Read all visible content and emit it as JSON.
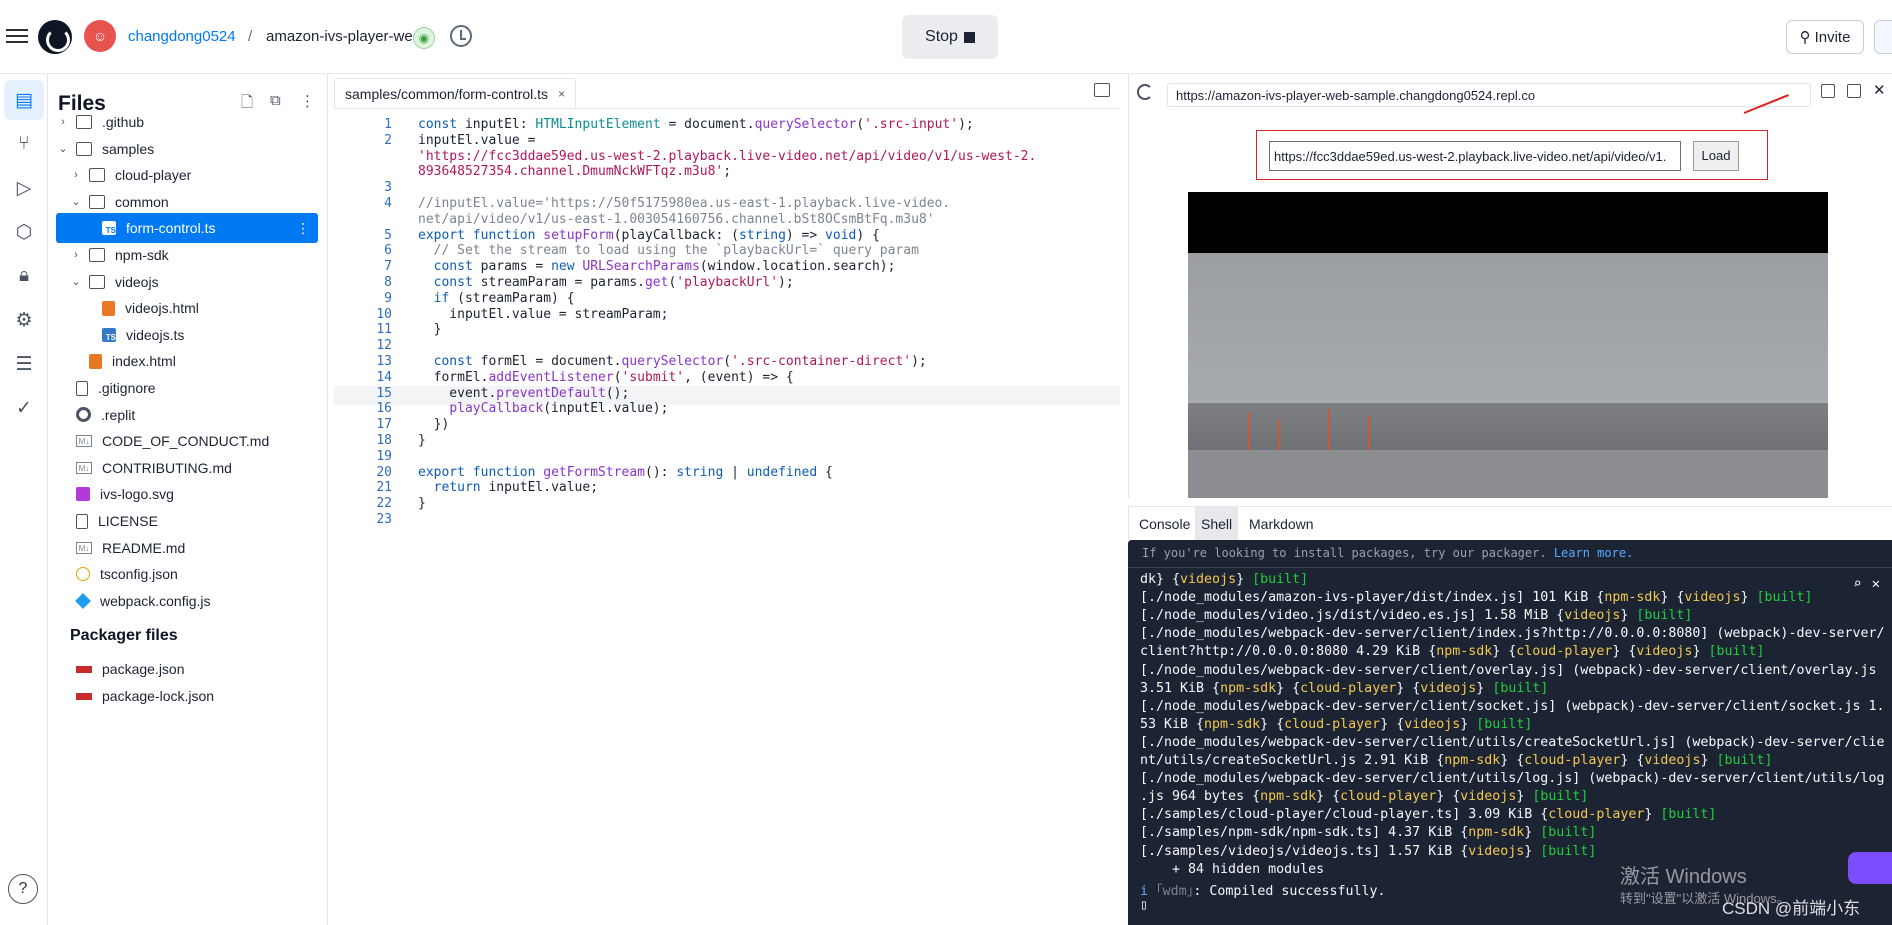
{
  "topbar": {
    "username": "changdong0524",
    "separator": "/",
    "repl_name": "amazon-ivs-player-we...",
    "stop_label": "Stop",
    "invite_label": "Invite",
    "avatar_glyph": "☺"
  },
  "files": {
    "title": "Files",
    "tree": [
      {
        "name": ".github",
        "kind": "folder",
        "chev": "›",
        "indent": 0
      },
      {
        "name": "samples",
        "kind": "folder",
        "chev": "⌄",
        "indent": 0
      },
      {
        "name": "cloud-player",
        "kind": "folder",
        "chev": "›",
        "indent": 1
      },
      {
        "name": "common",
        "kind": "folder",
        "chev": "⌄",
        "indent": 1
      },
      {
        "name": "form-control.ts",
        "kind": "ts",
        "chev": "",
        "indent": 2,
        "selected": true
      },
      {
        "name": "npm-sdk",
        "kind": "folder",
        "chev": "›",
        "indent": 1
      },
      {
        "name": "videojs",
        "kind": "folder",
        "chev": "⌄",
        "indent": 1
      },
      {
        "name": "videojs.html",
        "kind": "html",
        "chev": "",
        "indent": 2
      },
      {
        "name": "videojs.ts",
        "kind": "ts",
        "chev": "",
        "indent": 2
      },
      {
        "name": "index.html",
        "kind": "html",
        "chev": "",
        "indent": 1
      },
      {
        "name": ".gitignore",
        "kind": "file",
        "chev": "",
        "indent": 0
      },
      {
        "name": ".replit",
        "kind": "replit",
        "chev": "",
        "indent": 0
      },
      {
        "name": "CODE_OF_CONDUCT.md",
        "kind": "md",
        "chev": "",
        "indent": 0
      },
      {
        "name": "CONTRIBUTING.md",
        "kind": "md",
        "chev": "",
        "indent": 0
      },
      {
        "name": "ivs-logo.svg",
        "kind": "svg",
        "chev": "",
        "indent": 0
      },
      {
        "name": "LICENSE",
        "kind": "file",
        "chev": "",
        "indent": 0
      },
      {
        "name": "README.md",
        "kind": "md",
        "chev": "",
        "indent": 0
      },
      {
        "name": "tsconfig.json",
        "kind": "json",
        "chev": "",
        "indent": 0
      },
      {
        "name": "webpack.config.js",
        "kind": "web",
        "chev": "",
        "indent": 0
      }
    ],
    "packager_title": "Packager files",
    "packager": [
      {
        "name": "package.json",
        "kind": "npm"
      },
      {
        "name": "package-lock.json",
        "kind": "npm"
      }
    ],
    "help_label": "?"
  },
  "editor": {
    "tab_label": "samples/common/form-control.ts",
    "tab_close": "×",
    "lines": [
      {
        "n": "1",
        "html": "<span class='kw'>const</span> inputEl: <span class='ty'>HTMLInputElement</span> = document.<span class='fn'>querySelector</span>(<span class='str'>'.src-input'</span>);"
      },
      {
        "n": "2",
        "html": "inputEl.value ="
      },
      {
        "n": "",
        "html": "<span class='str'>'https://fcc3ddae59ed.us-west-2.playback.live-video.net/api/video/v1/us-west-2.</span>"
      },
      {
        "n": "",
        "html": "<span class='str'>893648527354.channel.DmumNckWFTqz.m3u8'</span>;"
      },
      {
        "n": "3",
        "html": ""
      },
      {
        "n": "4",
        "html": "<span class='cm'>//inputEl.value='https://50f5175980ea.us-east-1.playback.live-video.</span>"
      },
      {
        "n": "",
        "html": "<span class='cm'>net/api/video/v1/us-east-1.003054160756.channel.bSt8OCsmBtFq.m3u8'</span>"
      },
      {
        "n": "5",
        "html": "<span class='kw'>export</span> <span class='kw'>function</span> <span class='fn'>setupForm</span>(playCallback: (<span class='kw'>string</span>) => <span class='kw'>void</span>) {"
      },
      {
        "n": "6",
        "html": "  <span class='cm'>// Set the stream to load using the `playbackUrl=` query param</span>"
      },
      {
        "n": "7",
        "html": "  <span class='kw'>const</span> params = <span class='kw'>new</span> <span class='fn'>URLSearchParams</span>(window.location.search);"
      },
      {
        "n": "8",
        "html": "  <span class='kw'>const</span> streamParam = params.<span class='fn'>get</span>(<span class='str'>'playbackUrl'</span>);"
      },
      {
        "n": "9",
        "html": "  <span class='kw'>if</span> (streamParam) {"
      },
      {
        "n": "10",
        "html": "    inputEl.value = streamParam;"
      },
      {
        "n": "11",
        "html": "  }"
      },
      {
        "n": "12",
        "html": ""
      },
      {
        "n": "13",
        "html": "  <span class='kw'>const</span> formEl = document.<span class='fn'>querySelector</span>(<span class='str'>'.src-container-direct'</span>);"
      },
      {
        "n": "14",
        "html": "  formEl.<span class='fn'>addEventListener</span>(<span class='str'>'submit'</span>, (event) => {"
      },
      {
        "n": "15",
        "html": "    event.<span class='fn'>preventDefault</span>();",
        "highlight": true
      },
      {
        "n": "16",
        "html": "    <span class='fn'>playCallback</span>(inputEl.value);"
      },
      {
        "n": "17",
        "html": "  })"
      },
      {
        "n": "18",
        "html": "}"
      },
      {
        "n": "19",
        "html": ""
      },
      {
        "n": "20",
        "html": "<span class='kw'>export</span> <span class='kw'>function</span> <span class='fn'>getFormStream</span>(): <span class='kw'>string</span> | <span class='kw'>undefined</span> {"
      },
      {
        "n": "21",
        "html": "  <span class='kw'>return</span> inputEl.value;"
      },
      {
        "n": "22",
        "html": "}"
      },
      {
        "n": "23",
        "html": ""
      }
    ]
  },
  "preview": {
    "url": "https://amazon-ivs-player-web-sample.changdong0524.repl.co",
    "input_value": "https://fcc3ddae59ed.us-west-2.playback.live-video.net/api/video/v1.",
    "load_label": "Load"
  },
  "console": {
    "tabs": [
      "Console",
      "Shell",
      "Markdown"
    ],
    "active_tab": "Shell",
    "hint_text": "If you're looking to install packages, try our packager.",
    "hint_link": "Learn more.",
    "lines": [
      "dk} {<span class='y'>videojs</span>} <span class='g'>[built]</span>",
      "[./node_modules/amazon-ivs-player/dist/index.js] 101 KiB {<span class='y'>npm-sdk</span>} {<span class='y'>videojs</span>} <span class='g'>[built]</span>",
      "[./node_modules/video.js/dist/video.es.js] 1.58 MiB {<span class='y'>videojs</span>} <span class='g'>[built]</span>",
      "[./node_modules/webpack-dev-server/client/index.js?http://0.0.0.0:8080] (webpack)-dev-server/",
      "client?http://0.0.0.0:8080 4.29 KiB {<span class='y'>npm-sdk</span>} {<span class='y'>cloud-player</span>} {<span class='y'>videojs</span>} <span class='g'>[built]</span>",
      "[./node_modules/webpack-dev-server/client/overlay.js] (webpack)-dev-server/client/overlay.js",
      "3.51 KiB {<span class='y'>npm-sdk</span>} {<span class='y'>cloud-player</span>} {<span class='y'>videojs</span>} <span class='g'>[built]</span>",
      "[./node_modules/webpack-dev-server/client/socket.js] (webpack)-dev-server/client/socket.js 1.",
      "53 KiB {<span class='y'>npm-sdk</span>} {<span class='y'>cloud-player</span>} {<span class='y'>videojs</span>} <span class='g'>[built]</span>",
      "[./node_modules/webpack-dev-server/client/utils/createSocketUrl.js] (webpack)-dev-server/clie",
      "nt/utils/createSocketUrl.js 2.91 KiB {<span class='y'>npm-sdk</span>} {<span class='y'>cloud-player</span>} {<span class='y'>videojs</span>} <span class='g'>[built]</span>",
      "[./node_modules/webpack-dev-server/client/utils/log.js] (webpack)-dev-server/client/utils/log",
      ".js 964 bytes {<span class='y'>npm-sdk</span>} {<span class='y'>cloud-player</span>} {<span class='y'>videojs</span>} <span class='g'>[built]</span>",
      "[./samples/cloud-player/cloud-player.ts] 3.09 KiB {<span class='y'>cloud-player</span>} <span class='g'>[built]</span>",
      "[./samples/npm-sdk/npm-sdk.ts] 4.37 KiB {<span class='y'>npm-sdk</span>} <span class='g'>[built]</span>",
      "[./samples/videojs/videojs.ts] 1.57 KiB {<span class='y'>videojs</span>} <span class='g'>[built]</span>",
      "    + 84 hidden modules",
      "<span class='b'>i</span> <span class='dim'>｢wdm｣</span>: Compiled successfully."
    ]
  },
  "watermark": {
    "line1": "激活 Windows",
    "line2": "转到\"设置\"以激活 Windows。",
    "csdn": "CSDN @前端小东"
  }
}
